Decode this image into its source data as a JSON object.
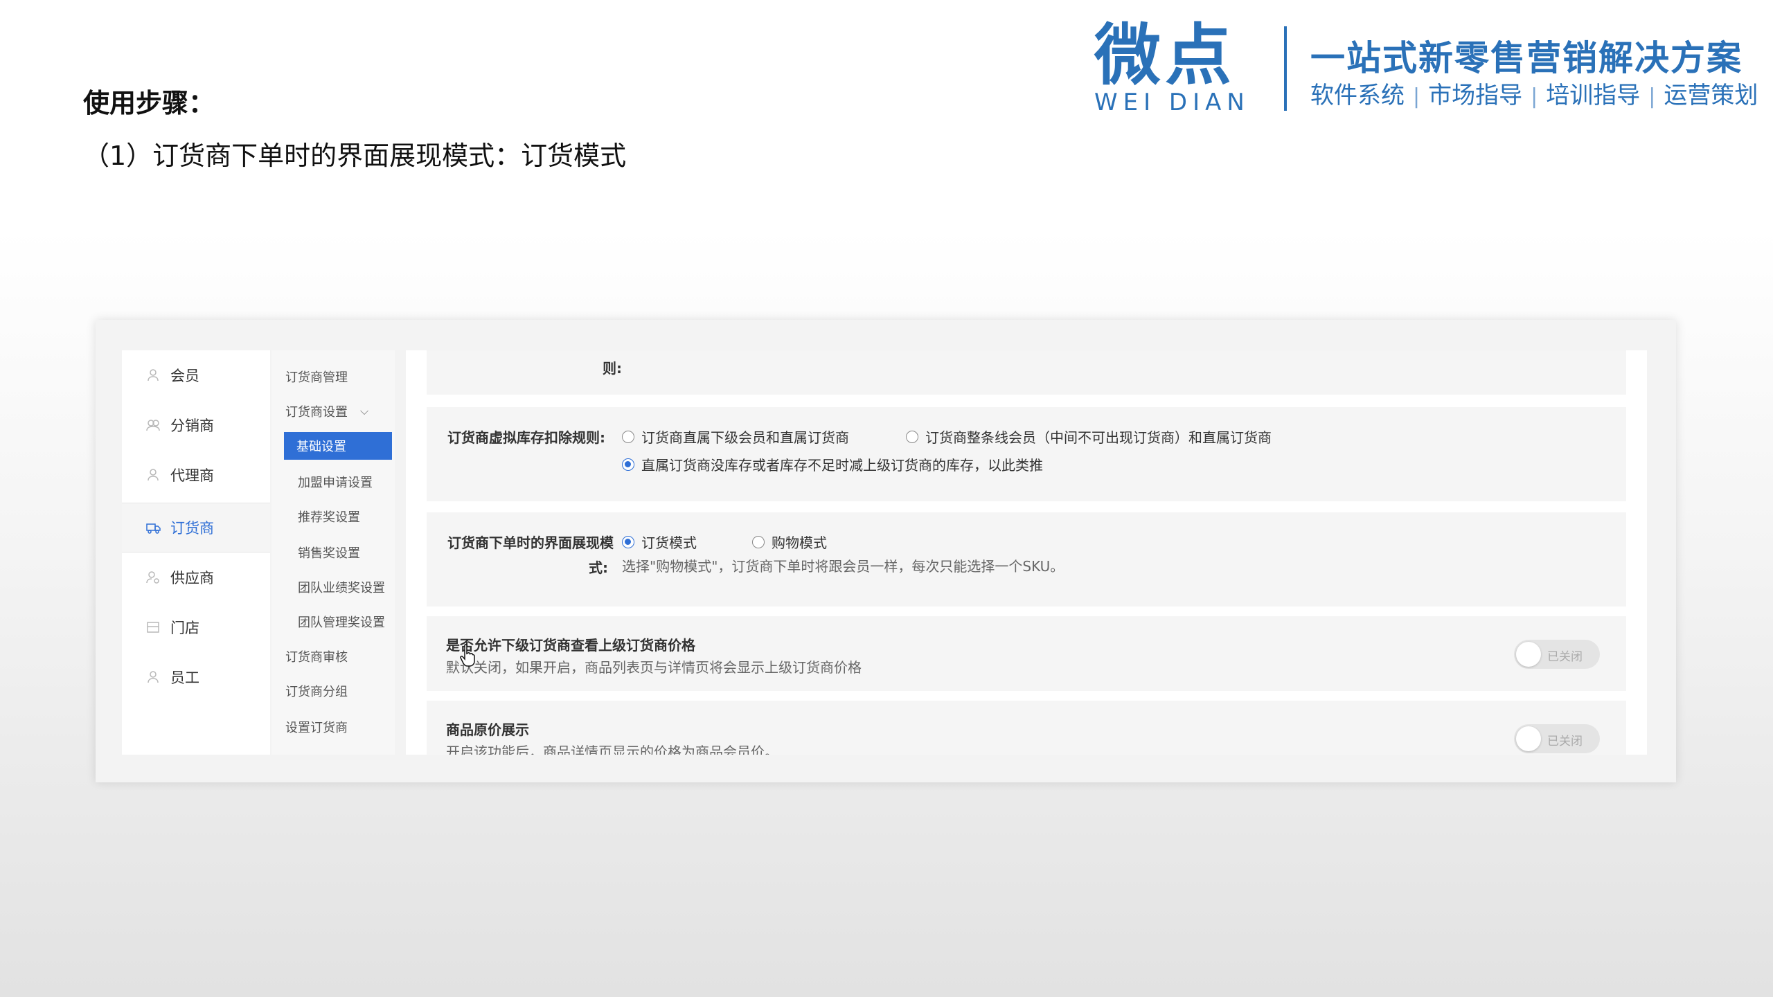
{
  "brand": {
    "logo_main": "微点",
    "logo_sub": "WEI DIAN",
    "slogan": "一站式新零售营销解决方案",
    "services": [
      "软件系统",
      "市场指导",
      "培训指导",
      "运营策划"
    ],
    "color": "#2a71b8"
  },
  "heading": {
    "title": "使用步骤：",
    "subtitle": "（1）订货商下单时的界面展现模式：订货模式"
  },
  "nav": {
    "items": [
      {
        "label": "会员",
        "icon": "user-icon"
      },
      {
        "label": "分销商",
        "icon": "group-icon"
      },
      {
        "label": "代理商",
        "icon": "user-icon"
      },
      {
        "label": "订货商",
        "icon": "truck-icon",
        "active": true
      },
      {
        "label": "供应商",
        "icon": "user-gear-icon"
      },
      {
        "label": "门店",
        "icon": "store-icon"
      },
      {
        "label": "员工",
        "icon": "user-icon"
      }
    ]
  },
  "subnav": {
    "items": [
      {
        "label": "订货商管理"
      },
      {
        "label": "订货商设置",
        "expanded": true
      },
      {
        "label": "基础设置",
        "active": true
      },
      {
        "label": "加盟申请设置"
      },
      {
        "label": "推荐奖设置"
      },
      {
        "label": "销售奖设置"
      },
      {
        "label": "团队业绩奖设置"
      },
      {
        "label": "团队管理奖设置"
      },
      {
        "label": "订货商审核"
      },
      {
        "label": "订货商分组"
      },
      {
        "label": "设置订货商"
      }
    ]
  },
  "settings": {
    "cut_label": "则:",
    "stock_rule": {
      "label": "订货商虚拟库存扣除规则:",
      "options": [
        "订货商直属下级会员和直属订货商",
        "订货商整条线会员（中间不可出现订货商）和直属订货商",
        "直属订货商没库存或者库存不足时减上级订货商的库存，以此类推"
      ],
      "selected": 2
    },
    "order_mode": {
      "label_line1": "订货商下单时的界面展现模",
      "label_line2": "式:",
      "options": [
        "订货模式",
        "购物模式"
      ],
      "selected": 0,
      "hint": "选择\"购物模式\"，订货商下单时将跟会员一样，每次只能选择一个SKU。"
    },
    "view_parent_price": {
      "title": "是否允许下级订货商查看上级订货商价格",
      "desc": "默认关闭，如果开启，商品列表页与详情页将会显示上级订货商价格",
      "toggle_label": "已关闭"
    },
    "original_price": {
      "title": "商品原价展示",
      "desc": "开启该功能后，商品详情页显示的价格为商品会员价。",
      "toggle_label": "已关闭"
    }
  }
}
